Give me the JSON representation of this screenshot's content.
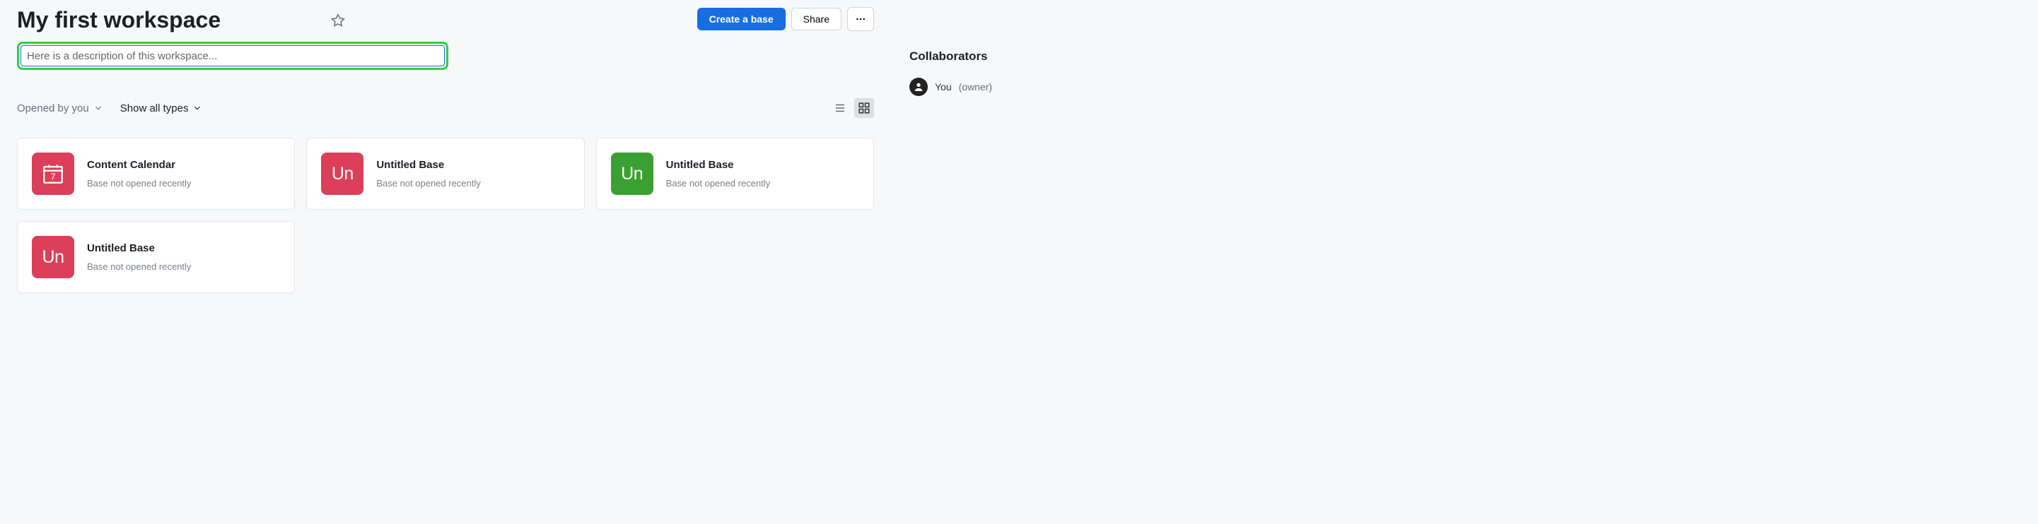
{
  "workspace": {
    "title": "My first workspace",
    "description_placeholder": "Here is a description of this workspace..."
  },
  "actions": {
    "create_base": "Create a base",
    "share": "Share"
  },
  "toolbar": {
    "sort_label": "Opened by you",
    "filter_label": "Show all types"
  },
  "bases": [
    {
      "name": "Content Calendar",
      "type": "Base",
      "meta": "not opened recently",
      "color": "red",
      "icon": "calendar",
      "abbrev": ""
    },
    {
      "name": "Untitled Base",
      "type": "Base",
      "meta": "not opened recently",
      "color": "red",
      "icon": "text",
      "abbrev": "Un"
    },
    {
      "name": "Untitled Base",
      "type": "Base",
      "meta": "not opened recently",
      "color": "green",
      "icon": "text",
      "abbrev": "Un"
    },
    {
      "name": "Untitled Base",
      "type": "Base",
      "meta": "not opened recently",
      "color": "red",
      "icon": "text",
      "abbrev": "Un"
    }
  ],
  "collaborators": {
    "heading": "Collaborators",
    "items": [
      {
        "name": "You",
        "role": "(owner)"
      }
    ]
  }
}
